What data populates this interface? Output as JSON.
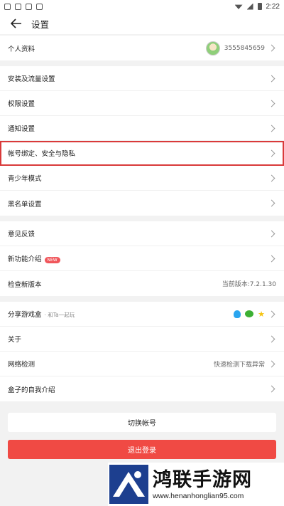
{
  "status_bar": {
    "time": "2:22"
  },
  "header": {
    "title": "设置"
  },
  "profile": {
    "label": "个人资料",
    "user_id": "3555845659"
  },
  "group1": [
    {
      "label": "安装及流量设置"
    },
    {
      "label": "权限设置"
    },
    {
      "label": "通知设置"
    },
    {
      "label": "帐号绑定、安全与隐私"
    },
    {
      "label": "青少年模式"
    },
    {
      "label": "黑名单设置"
    }
  ],
  "group2": {
    "feedback": "意见反馈",
    "new_features": "新功能介绍",
    "new_badge": "NEW",
    "check_version": "检查新版本",
    "current_version": "当前版本:7.2.1.30"
  },
  "group3": {
    "share": "分享游戏盒",
    "share_sub": "· 和Ta一起玩",
    "about": "关于",
    "network": "网络检测",
    "network_hint": "快速检测下载异常",
    "intro": "盒子的自我介绍"
  },
  "buttons": {
    "switch": "切换帐号",
    "logout": "退出登录"
  },
  "watermark": {
    "title": "鸿联手游网",
    "url": "www.henanhonglian95.com"
  },
  "colors": {
    "accent": "#f04a44",
    "highlight_border": "#d93a3a"
  },
  "icons": [
    "back-arrow-icon",
    "chevron-right-icon",
    "qq-icon",
    "wechat-icon",
    "qzone-star-icon"
  ]
}
